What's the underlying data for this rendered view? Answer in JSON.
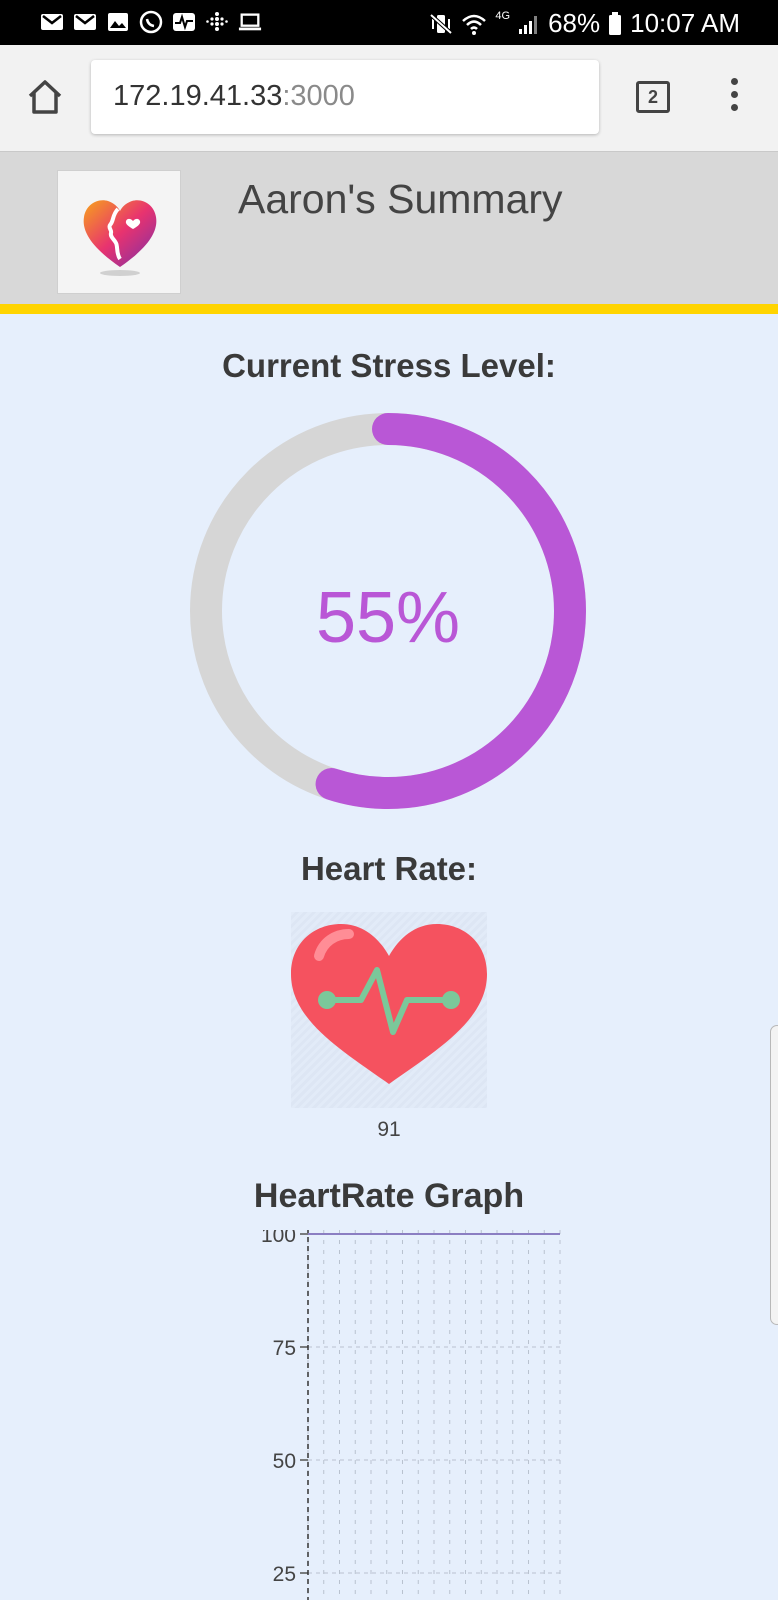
{
  "status_bar": {
    "left_icons": [
      "gmail-icon",
      "gmail-icon",
      "gallery-icon",
      "whatsapp-icon",
      "health-icon",
      "fitbit-icon",
      "laptop-icon"
    ],
    "battery": "68%",
    "time": "10:07 AM",
    "network": "4G"
  },
  "browser": {
    "url_host": "172.19.41.33",
    "url_port": ":3000",
    "tab_count": "2"
  },
  "header": {
    "title": "Aaron's Summary"
  },
  "stress": {
    "title": "Current Stress Level:",
    "value_label": "55%",
    "value": 55,
    "color": "#b957d6",
    "track_color": "#d6d6d6"
  },
  "heart_rate": {
    "title": "Heart Rate:",
    "value": "91"
  },
  "graph": {
    "title": "HeartRate Graph"
  },
  "chart_data": {
    "type": "line",
    "title": "HeartRate Graph",
    "yticks": [
      "100",
      "75",
      "50",
      "25"
    ],
    "ylim": [
      0,
      100
    ],
    "series": [
      {
        "values": [
          100,
          100
        ]
      }
    ],
    "grid": true
  },
  "colors": {
    "accent_bar": "#ffd400",
    "page_bg": "#e6effc",
    "heart": "#f5525f",
    "pulse": "#7bc89a"
  }
}
